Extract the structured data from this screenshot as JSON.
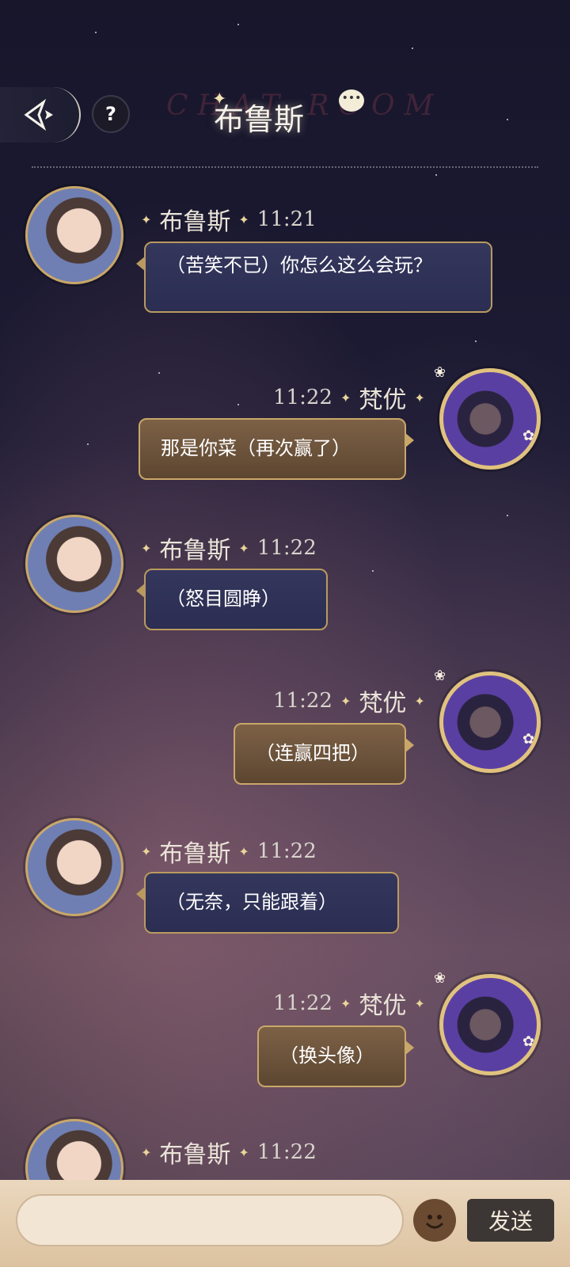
{
  "header": {
    "title": "布鲁斯",
    "watermark": "CHAT ROOM",
    "help_label": "?"
  },
  "messages": [
    {
      "side": "left",
      "name": "布鲁斯",
      "time": "11:21",
      "text": "（苦笑不已）你怎么这么会玩？"
    },
    {
      "side": "right",
      "name": "梵优",
      "time": "11:22",
      "text": "那是你菜（再次赢了）"
    },
    {
      "side": "left",
      "name": "布鲁斯",
      "time": "11:22",
      "text": "（怒目圆睁）"
    },
    {
      "side": "right",
      "name": "梵优",
      "time": "11:22",
      "text": "（连赢四把）"
    },
    {
      "side": "left",
      "name": "布鲁斯",
      "time": "11:22",
      "text": "（无奈，只能跟着）"
    },
    {
      "side": "right",
      "name": "梵优",
      "time": "11:22",
      "text": "（换头像）"
    },
    {
      "side": "left",
      "name": "布鲁斯",
      "time": "11:22",
      "text": ""
    }
  ],
  "input_bar": {
    "placeholder": "",
    "send_label": "发送",
    "emoji_icon": "smile-face-icon"
  },
  "colors": {
    "left_bubble": "#2f3256",
    "right_bubble": "#6e553d",
    "gold_border": "#c9a769"
  }
}
